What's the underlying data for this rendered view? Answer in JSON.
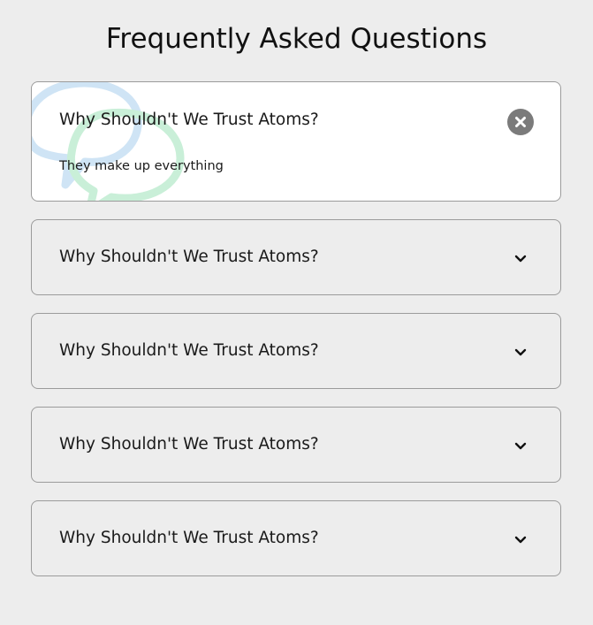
{
  "title": "Frequently Asked Questions",
  "faqs": [
    {
      "question": "Why Shouldn't We Trust Atoms?",
      "answer": "They make up everything",
      "state": "open",
      "toggle_icon": "close-icon"
    },
    {
      "question": "Why Shouldn't We Trust Atoms?",
      "state": "closed",
      "toggle_icon": "chevron-down-icon"
    },
    {
      "question": "Why Shouldn't We Trust Atoms?",
      "state": "closed",
      "toggle_icon": "chevron-down-icon"
    },
    {
      "question": "Why Shouldn't We Trust Atoms?",
      "state": "closed",
      "toggle_icon": "chevron-down-icon"
    },
    {
      "question": "Why Shouldn't We Trust Atoms?",
      "state": "closed",
      "toggle_icon": "chevron-down-icon"
    }
  ],
  "colors": {
    "background": "#ededed",
    "active_card": "#ffffff",
    "border": "#9b9b9b",
    "close_button": "#7b7b7b",
    "bubble_blue": "#cfe4f5",
    "bubble_green": "#c9efd8"
  },
  "decoration_icon": "speech-bubbles-icon"
}
